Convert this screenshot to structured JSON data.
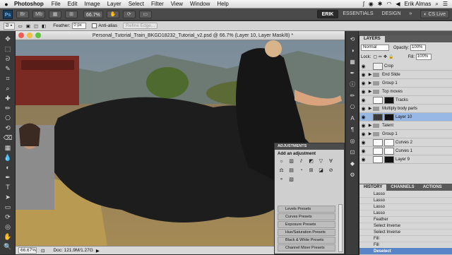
{
  "menubar": {
    "apple": "",
    "app_name": "Photoshop",
    "items": [
      "File",
      "Edit",
      "Image",
      "Layer",
      "Select",
      "Filter",
      "View",
      "Window",
      "Help"
    ],
    "user": "Erik Almas"
  },
  "appbar": {
    "ps_logo": "Ps",
    "zoom": "66.7%",
    "workspaces": [
      "ERIK",
      "ESSENTIALS",
      "DESIGN"
    ],
    "active_workspace": "ERIK",
    "more": "»",
    "cs_live": "CS Live"
  },
  "options": {
    "feather_label": "Feather:",
    "feather_value": "0 px",
    "antialias_label": "Anti-alias",
    "refine_edge": "Refine Edge..."
  },
  "document": {
    "title": "Personal_Tutorial_Train_BKGD18232_Tutorial_v2.psd @ 66.7% (Layer 10, Layer Mask/8) *",
    "zoom": "66.67%",
    "doc_info": "Doc: 121.9M/1.27G"
  },
  "tools": {
    "icons": [
      "move-icon",
      "marquee-icon",
      "lasso-icon",
      "quick-select-icon",
      "crop-icon",
      "eyedropper-icon",
      "healing-icon",
      "brush-icon",
      "stamp-icon",
      "history-brush-icon",
      "eraser-icon",
      "gradient-icon",
      "blur-icon",
      "dodge-icon",
      "pen-icon",
      "type-icon",
      "path-select-icon",
      "shape-icon",
      "3d-rotate-icon",
      "3d-orbit-icon",
      "hand-icon",
      "zoom-icon"
    ],
    "glyphs": [
      "✥",
      "⬚",
      "ᘐ",
      "✎",
      "⌗",
      "⌕",
      "✚",
      "✏",
      "⎔",
      "⟲",
      "⌫",
      "▦",
      "💧",
      "◐",
      "✒",
      "T",
      "➤",
      "▭",
      "⟳",
      "◎",
      "✋",
      "🔍"
    ]
  },
  "layers_panel": {
    "tabs": [
      "LAYERS"
    ],
    "blend_mode": "Normal",
    "opacity_label": "Opacity:",
    "opacity": "100%",
    "lock_label": "Lock:",
    "fill_label": "Fill:",
    "fill": "100%",
    "layers": [
      {
        "name": "Crop",
        "type": "adjust"
      },
      {
        "name": "End Slide",
        "type": "group"
      },
      {
        "name": "Group 1",
        "type": "group"
      },
      {
        "name": "Top moves",
        "type": "group"
      },
      {
        "name": "Tracks",
        "type": "masked"
      },
      {
        "name": "Multiply body parts",
        "type": "group"
      },
      {
        "name": "Layer 10",
        "type": "selected"
      },
      {
        "name": "Talent",
        "type": "group"
      },
      {
        "name": "Group 1",
        "type": "group"
      },
      {
        "name": "Curves 2",
        "type": "curves"
      },
      {
        "name": "Curves 1",
        "type": "curves"
      },
      {
        "name": "Layer 9",
        "type": "masked"
      }
    ]
  },
  "adjustments_panel": {
    "tab": "ADJUSTMENTS",
    "title": "Add an adjustment",
    "icons_row1": [
      "☼",
      "▥",
      "⫽",
      "◩",
      "▽"
    ],
    "icons_row2": [
      "∀",
      "⚖",
      "▤",
      "◔",
      "⊞"
    ],
    "icons_row3": [
      "◪",
      "⊘",
      "⚬",
      "▧"
    ],
    "presets": [
      "Levels Presets",
      "Curves Presets",
      "Exposure Presets",
      "Hue/Saturation Presets",
      "Black & White Presets",
      "Channel Mixer Presets"
    ]
  },
  "history_panel": {
    "tabs": [
      "HISTORY",
      "CHANNELS",
      "ACTIONS"
    ],
    "active_tab": "HISTORY",
    "items": [
      "Lasso",
      "Lasso",
      "Lasso",
      "Lasso",
      "Feather",
      "Select Inverse",
      "Select Inverse",
      "Fill",
      "Fill",
      "Deselect"
    ],
    "selected_index": 9
  },
  "colors": {
    "selection": "#97b7e4",
    "history_selection": "#5a84c8"
  }
}
